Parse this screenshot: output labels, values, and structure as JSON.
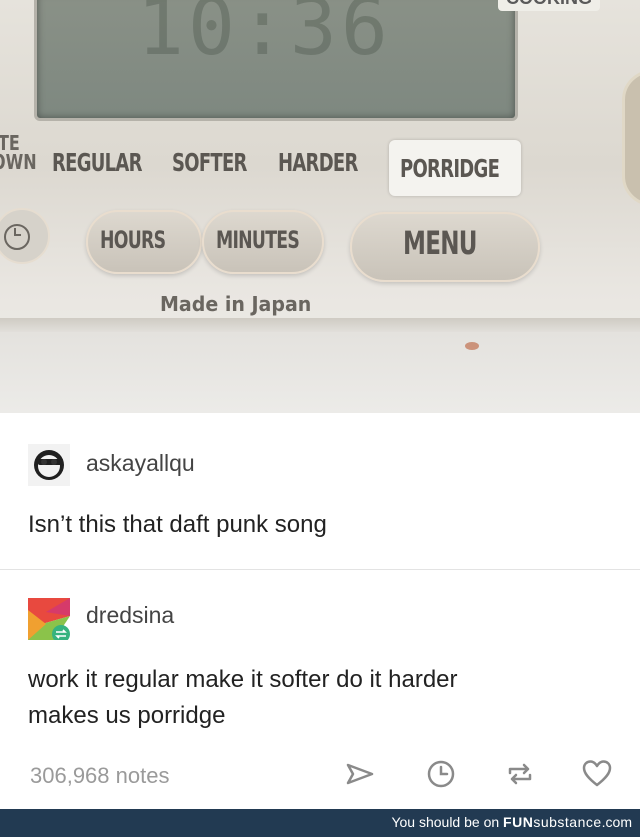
{
  "photo": {
    "lcd_digits": "10:36",
    "lcd_word": "COOKING",
    "left_partial_label_top": "ITE",
    "left_partial_label_bottom": "OWN",
    "modes": [
      "REGULAR",
      "SOFTER",
      "HARDER",
      "PORRIDGE"
    ],
    "buttons": [
      "HOURS",
      "MINUTES",
      "MENU"
    ],
    "made_in": "Made in Japan"
  },
  "post1": {
    "username": "askayallqu",
    "text": "Isn’t this that daft punk song"
  },
  "post2": {
    "username": "dredsina",
    "text_line1": "work it regular make it softer do it harder",
    "text_line2": "makes us porridge"
  },
  "footer_actions": {
    "notes": "306,968 notes",
    "icons": [
      "send-icon",
      "clock-icon",
      "reblog-icon",
      "heart-icon"
    ]
  },
  "watermark": {
    "prefix": "You should be on ",
    "brand_a": "FUN",
    "brand_b": "substance",
    "suffix": ".com"
  },
  "colors": {
    "footer_bg": "#223a52",
    "text": "#222222",
    "muted": "#9a9a9a"
  }
}
